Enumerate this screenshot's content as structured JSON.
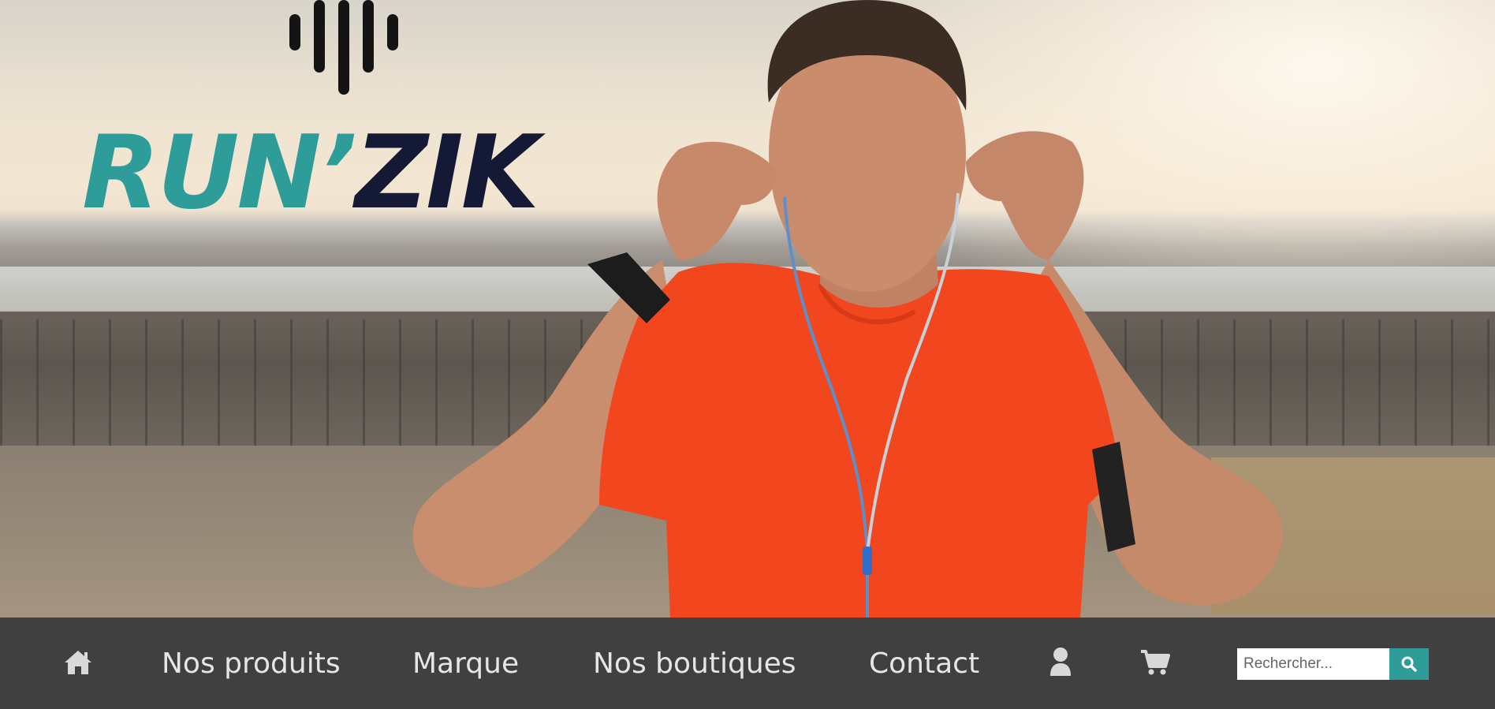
{
  "logo": {
    "run_text": "RUN’",
    "zik_text": "ZIK",
    "colors": {
      "run": "#2e9c98",
      "zik": "#141a35"
    },
    "icon": "sound-wave-bars-icon"
  },
  "hero": {
    "image": "runner-with-earphones-photo"
  },
  "nav": {
    "background": "#404040",
    "home_icon": "home-icon",
    "links": {
      "products": "Nos produits",
      "brand": "Marque",
      "shops": "Nos boutiques",
      "contact": "Contact"
    },
    "user_icon": "user-icon",
    "cart_icon": "shopping-cart-icon"
  },
  "search": {
    "placeholder": "Rechercher...",
    "value": "",
    "button_icon": "search-icon",
    "accent": "#2e9c98"
  }
}
